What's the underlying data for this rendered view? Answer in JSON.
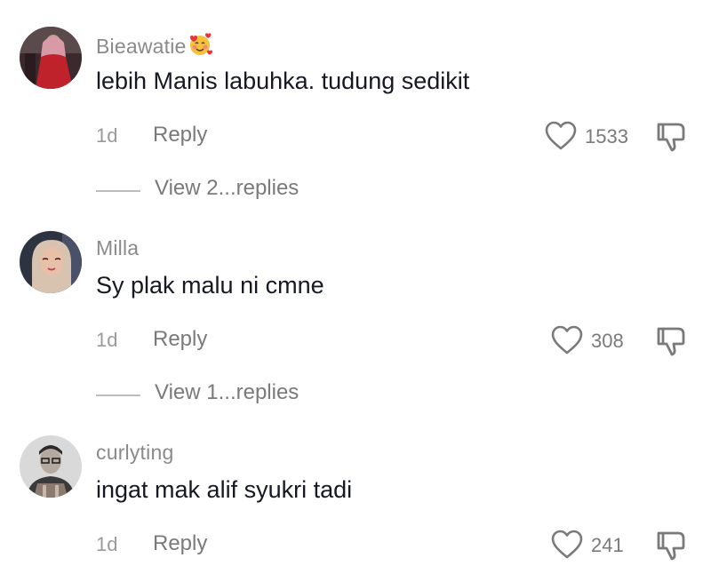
{
  "comments": [
    {
      "username": "Bieawatie",
      "username_emoji": "smiling-face-with-hearts",
      "text": "lebih Manis labuhka. tudung sedikit",
      "time": "1d",
      "reply_label": "Reply",
      "likes": "1533",
      "view_replies": "View 2...replies"
    },
    {
      "username": "Milla",
      "text": "Sy plak malu ni cmne",
      "time": "1d",
      "reply_label": "Reply",
      "likes": "308",
      "view_replies": "View 1...replies"
    },
    {
      "username": "curlyting",
      "text": "ingat mak alif syukri tadi",
      "time": "1d",
      "reply_label": "Reply",
      "likes": "241"
    }
  ],
  "icons": {
    "like": "heart-outline-icon",
    "dislike": "thumbs-down-outline-icon"
  },
  "colors": {
    "text": "#161823",
    "username": "#8a8a8a",
    "meta": "#7a7a7a"
  }
}
